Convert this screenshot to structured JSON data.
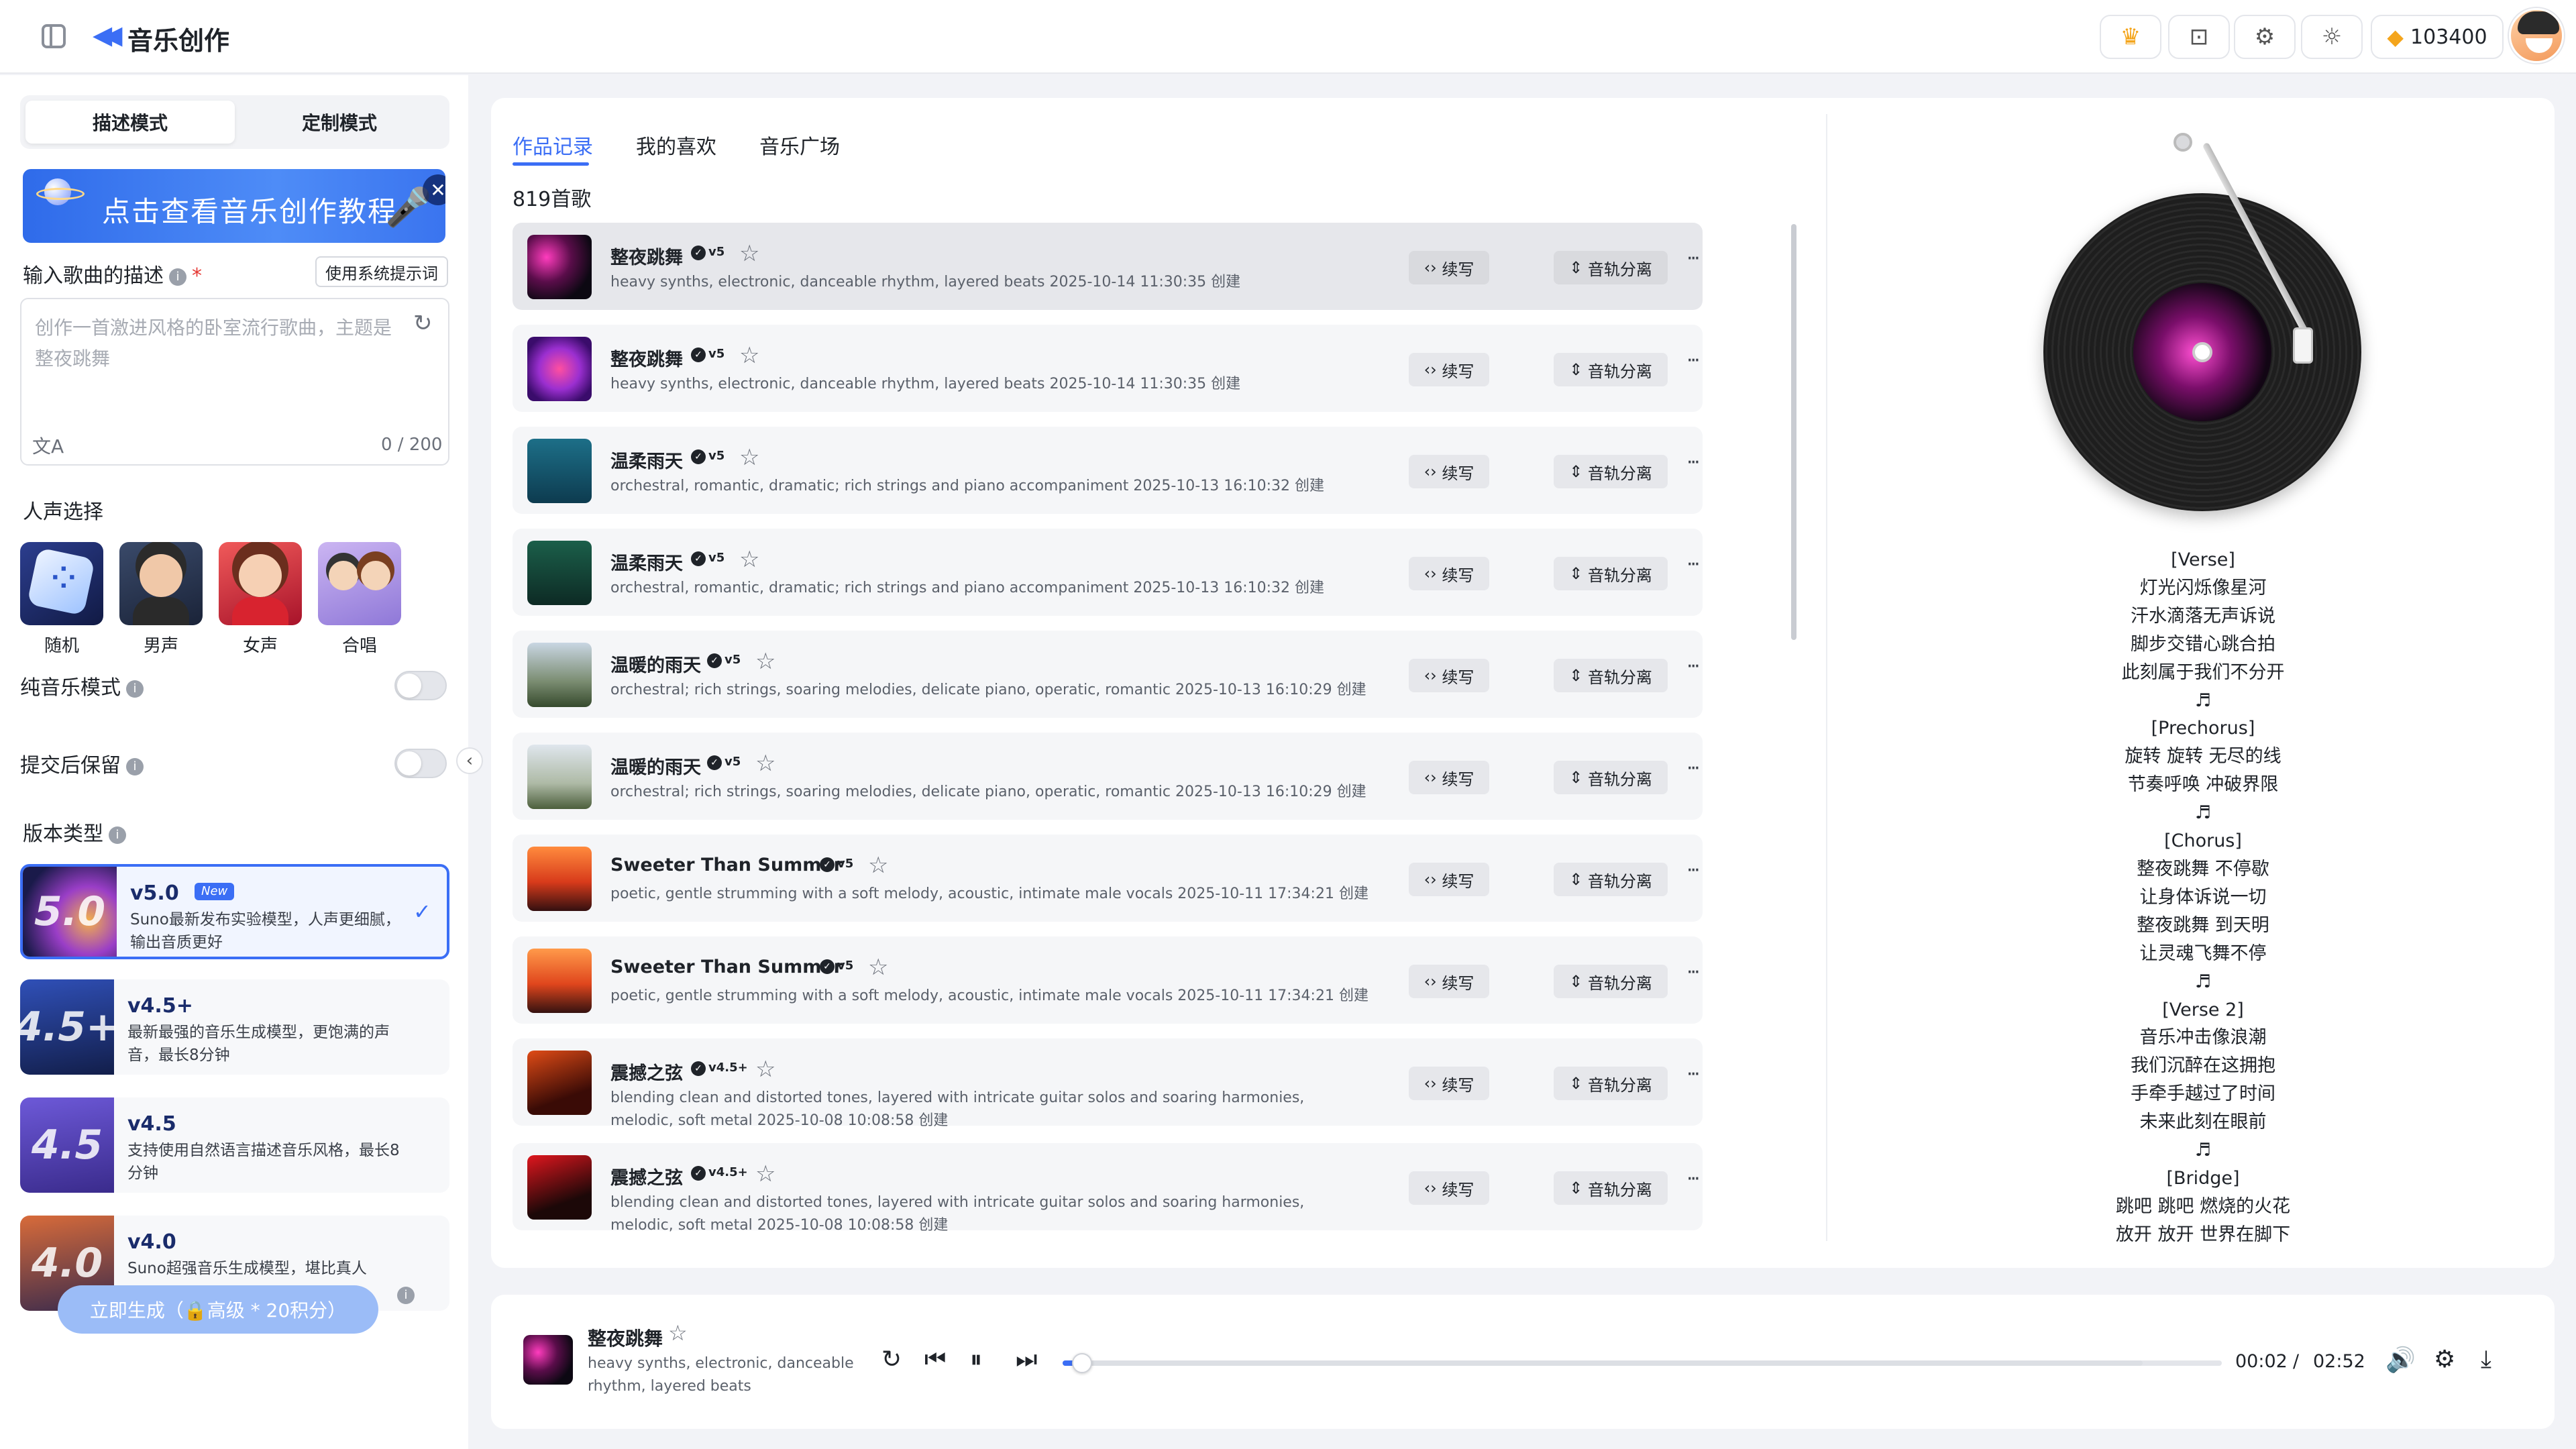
{
  "header": {
    "title": "音乐创作",
    "points": "103400"
  },
  "left": {
    "modes": [
      "描述模式",
      "定制模式"
    ],
    "banner_text": "点击查看音乐创作教程",
    "desc_label": "输入歌曲的描述",
    "required_mark": "*",
    "system_prompt_button": "使用系统提示词",
    "desc_placeholder": "创作一首激进风格的卧室流行歌曲，主题是整夜跳舞",
    "char_count": "0 / 200",
    "voice_label": "人声选择",
    "voices": [
      "随机",
      "男声",
      "女声",
      "合唱"
    ],
    "pure_music_label": "纯音乐模式",
    "keep_after_submit_label": "提交后保留",
    "version_label": "版本类型",
    "versions": [
      {
        "name": "v5.0",
        "tag": "New",
        "desc": "Suno最新发布实验模型，人声更细腻，输出音质更好",
        "thumb": "5.0"
      },
      {
        "name": "v4.5+",
        "desc": "最新最强的音乐生成模型，更饱满的声音，最长8分钟",
        "thumb": "4.5+"
      },
      {
        "name": "v4.5",
        "desc": "支持使用自然语言描述音乐风格，最长8分钟",
        "thumb": "4.5"
      },
      {
        "name": "v4.0",
        "desc": "Suno超强音乐生成模型，堪比真人",
        "thumb": "4.0"
      }
    ],
    "generate_button": "立即生成（🔒高级 * 20积分）"
  },
  "center": {
    "tabs": [
      "作品记录",
      "我的喜欢",
      "音乐广场"
    ],
    "song_count": "819首歌",
    "action_continue": "续写",
    "action_split": "音轨分离",
    "songs": [
      {
        "title": "整夜跳舞",
        "ver": "v5",
        "desc": "heavy synths, electronic, danceable rhythm, layered beats  2025-10-14 11:30:35 创建"
      },
      {
        "title": "整夜跳舞",
        "ver": "v5",
        "desc": "heavy synths, electronic, danceable rhythm, layered beats  2025-10-14 11:30:35 创建"
      },
      {
        "title": "温柔雨天",
        "ver": "v5",
        "desc": "orchestral, romantic, dramatic; rich strings and piano accompaniment  2025-10-13 16:10:32 创建"
      },
      {
        "title": "温柔雨天",
        "ver": "v5",
        "desc": "orchestral, romantic, dramatic; rich strings and piano accompaniment  2025-10-13 16:10:32 创建"
      },
      {
        "title": "温暖的雨天",
        "ver": "v5",
        "desc": "orchestral; rich strings, soaring melodies, delicate piano, operatic, romantic  2025-10-13 16:10:29 创建"
      },
      {
        "title": "温暖的雨天",
        "ver": "v5",
        "desc": "orchestral; rich strings, soaring melodies, delicate piano, operatic, romantic  2025-10-13 16:10:29 创建"
      },
      {
        "title": "Sweeter Than Summer",
        "ver": "v5",
        "desc": "poetic, gentle strumming with a soft melody, acoustic, intimate male vocals  2025-10-11 17:34:21 创建"
      },
      {
        "title": "Sweeter Than Summer",
        "ver": "v5",
        "desc": "poetic, gentle strumming with a soft melody, acoustic, intimate male vocals  2025-10-11 17:34:21 创建"
      },
      {
        "title": "震撼之弦",
        "ver": "v4.5+",
        "desc": "blending clean and distorted tones, layered with intricate guitar solos and soaring harmonies, melodic, soft metal  2025-10-08 10:08:58 创建"
      },
      {
        "title": "震撼之弦",
        "ver": "v4.5+",
        "desc": "blending clean and distorted tones, layered with intricate guitar solos and soaring harmonies, melodic, soft metal  2025-10-08 10:08:58 创建"
      }
    ],
    "lyrics": [
      "[Verse]",
      "灯光闪烁像星河",
      "汗水滴落无声诉说",
      "脚步交错心跳合拍",
      "此刻属于我们不分开",
      "♬",
      "[Prechorus]",
      "旋转 旋转 无尽的线",
      "节奏呼唤 冲破界限",
      "♬",
      "[Chorus]",
      "整夜跳舞 不停歇",
      "让身体诉说一切",
      "整夜跳舞 到天明",
      "让灵魂飞舞不停",
      "♬",
      "[Verse 2]",
      "音乐冲击像浪潮",
      "我们沉醉在这拥抱",
      "手牵手越过了时间",
      "未来此刻在眼前",
      "♬",
      "[Bridge]",
      "跳吧 跳吧 燃烧的火花",
      "放开 放开 世界在脚下"
    ]
  },
  "player": {
    "title": "整夜跳舞",
    "desc": "heavy synths, electronic, danceable rhythm, layered beats",
    "current_time": "00:02",
    "separator": "/",
    "total_time": "02:52",
    "progress": 0.012
  },
  "colors": {
    "accent": "#3b6ef5",
    "points_gem": "#f4a51c"
  }
}
